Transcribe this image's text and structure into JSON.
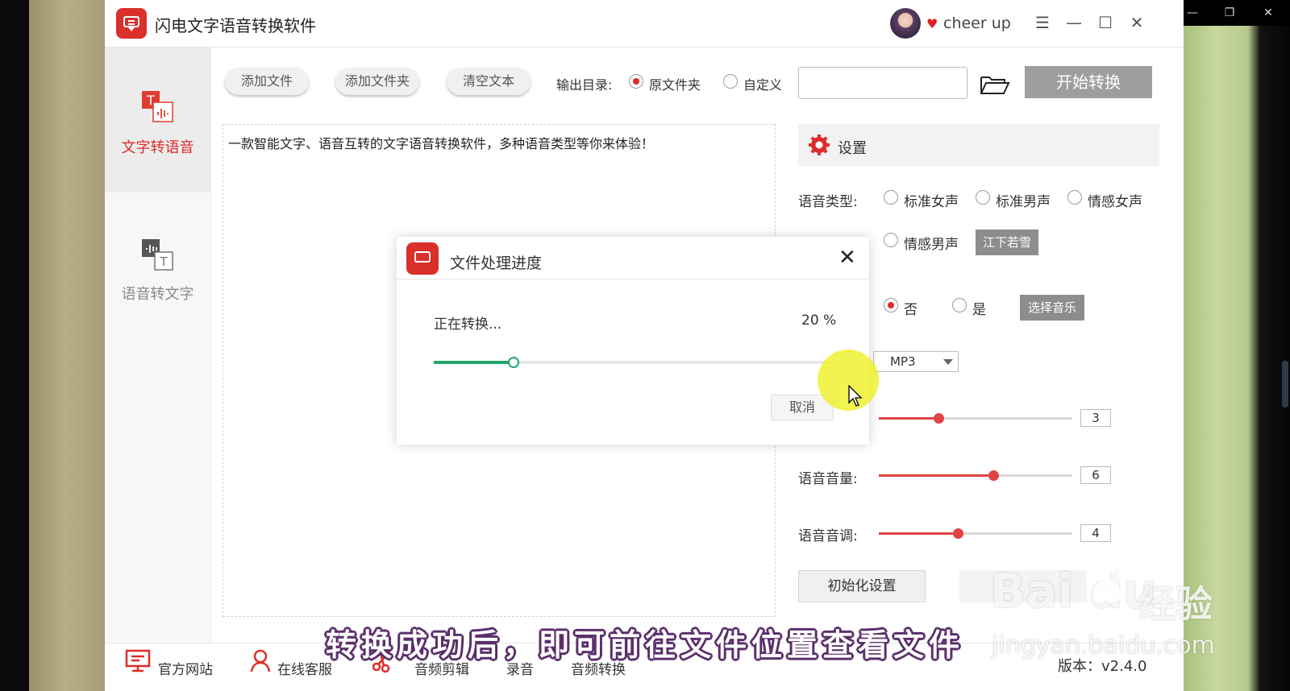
{
  "app": {
    "title": "闪电文字语音转换软件",
    "username": "cheer up",
    "version": "版本：v2.4.0"
  },
  "sidebar": {
    "items": [
      {
        "label": "文字转语音",
        "active": true
      },
      {
        "label": "语音转文字",
        "active": false
      }
    ]
  },
  "toolbar": {
    "add_file": "添加文件",
    "add_folder": "添加文件夹",
    "clear_text": "清空文本",
    "output_label": "输出目录:",
    "output_original": "原文件夹",
    "output_custom": "自定义",
    "output_path": "",
    "start": "开始转换"
  },
  "editor": {
    "text": "一款智能文字、语音互转的文字语音转换软件，多种语音类型等你来体验！"
  },
  "settings": {
    "title": "设置",
    "voice_type_label": "语音类型:",
    "voice_options": [
      "标准女声",
      "标准男声",
      "情感女声",
      "情感男声"
    ],
    "voice_extra_button": "江下若雪",
    "bgm_no": "否",
    "bgm_yes": "是",
    "choose_music": "选择音乐",
    "format": "MP3",
    "speed_value": "3",
    "volume_label": "语音音量:",
    "volume_value": "6",
    "pitch_label": "语音音调:",
    "pitch_value": "4",
    "init_button": "初始化设置"
  },
  "dialog": {
    "title": "文件处理进度",
    "status": "正在转换...",
    "percent_text": "20 %",
    "progress": 0.2,
    "cancel": "取消"
  },
  "bottom": {
    "website": "官方网站",
    "service": "在线客服",
    "audio_edit": "音频剪辑",
    "record": "录音",
    "audio_convert": "音频转换"
  },
  "overlay": {
    "subtitle": "转换成功后，即可前往文件位置查看文件",
    "watermark_logo": "Bai du",
    "watermark_cn": "经验",
    "watermark_url": "jingyan.baidu.com"
  },
  "colors": {
    "accent_red": "#d9302c",
    "progress_green": "#23a46b",
    "slider_red": "#e04343",
    "button_gray": "#9e9e9e"
  },
  "sliders": {
    "speed_fraction": 0.31,
    "volume_fraction": 0.59,
    "pitch_fraction": 0.41
  }
}
